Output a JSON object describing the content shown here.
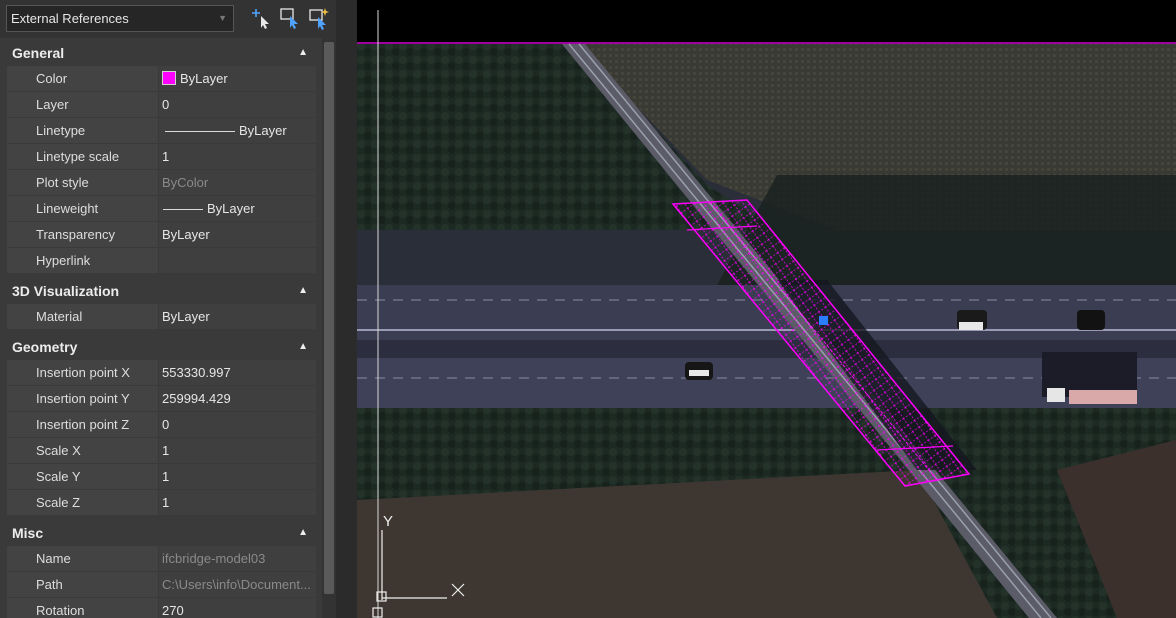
{
  "toolbar": {
    "dropdown_value": "External References",
    "icons": [
      "quick-select-icon",
      "select-objects-icon",
      "toggle-pickadd-icon"
    ]
  },
  "sections": {
    "general": "General",
    "visualization": "3D Visualization",
    "geometry": "Geometry",
    "misc": "Misc"
  },
  "general": {
    "color_label": "Color",
    "color_value": "ByLayer",
    "color_swatch": "#ff00ff",
    "layer_label": "Layer",
    "layer_value": "0",
    "linetype_label": "Linetype",
    "linetype_value": "ByLayer",
    "linetype_scale_label": "Linetype scale",
    "linetype_scale_value": "1",
    "plot_style_label": "Plot style",
    "plot_style_value": "ByColor",
    "lineweight_label": "Lineweight",
    "lineweight_value": "ByLayer",
    "transparency_label": "Transparency",
    "transparency_value": "ByLayer",
    "hyperlink_label": "Hyperlink",
    "hyperlink_value": ""
  },
  "visualization": {
    "material_label": "Material",
    "material_value": "ByLayer"
  },
  "geometry": {
    "ipx_label": "Insertion point X",
    "ipx_value": "553330.997",
    "ipy_label": "Insertion point Y",
    "ipy_value": "259994.429",
    "ipz_label": "Insertion point Z",
    "ipz_value": "0",
    "sx_label": "Scale X",
    "sx_value": "1",
    "sy_label": "Scale Y",
    "sy_value": "1",
    "sz_label": "Scale Z",
    "sz_value": "1"
  },
  "misc": {
    "name_label": "Name",
    "name_value": "ifcbridge-model03",
    "path_label": "Path",
    "path_value": "C:\\Users\\info\\Document...",
    "rotation_label": "Rotation",
    "rotation_value": "270"
  },
  "viewport": {
    "ucs_y_label": "Y",
    "ucs_x_label": "X",
    "highlight_color": "#ff00ff"
  }
}
